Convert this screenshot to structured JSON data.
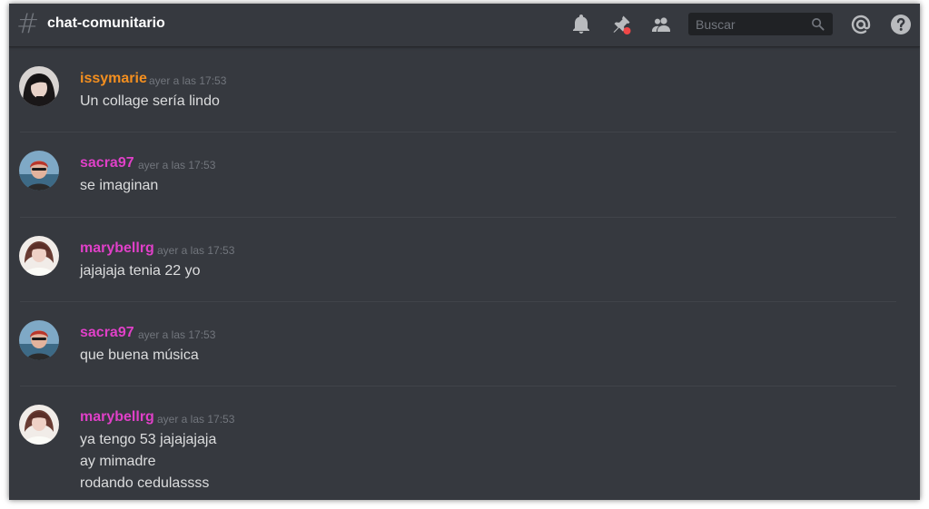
{
  "header": {
    "hash_symbol": "#",
    "channel_name": "chat-comunitario",
    "search_placeholder": "Buscar",
    "icons": [
      "bell-icon",
      "pin-icon",
      "members-icon",
      "search-icon",
      "mention-icon",
      "help-icon"
    ]
  },
  "colors": {
    "background": "#36393f",
    "orange_user": "#f48f1f",
    "pink_user": "#e040c8",
    "text": "#dcddde",
    "muted": "#72767d",
    "notification_dot": "#f04747"
  },
  "messages": [
    {
      "username": "issymarie",
      "timestamp": "ayer a las 17:53",
      "lines": [
        "Un collage sería lindo"
      ]
    },
    {
      "username": "sacra97",
      "timestamp": "ayer a las 17:53",
      "lines": [
        "se imaginan"
      ]
    },
    {
      "username": "marybellrg",
      "timestamp": "ayer a las 17:53",
      "lines": [
        "jajajaja tenia 22 yo"
      ]
    },
    {
      "username": "sacra97",
      "timestamp": "ayer a las 17:53",
      "lines": [
        "que buena música"
      ]
    },
    {
      "username": "marybellrg",
      "timestamp": "ayer a las 17:53",
      "lines": [
        "ya tengo 53 jajajajaja",
        "ay mimadre",
        "rodando cedulassss"
      ]
    }
  ]
}
